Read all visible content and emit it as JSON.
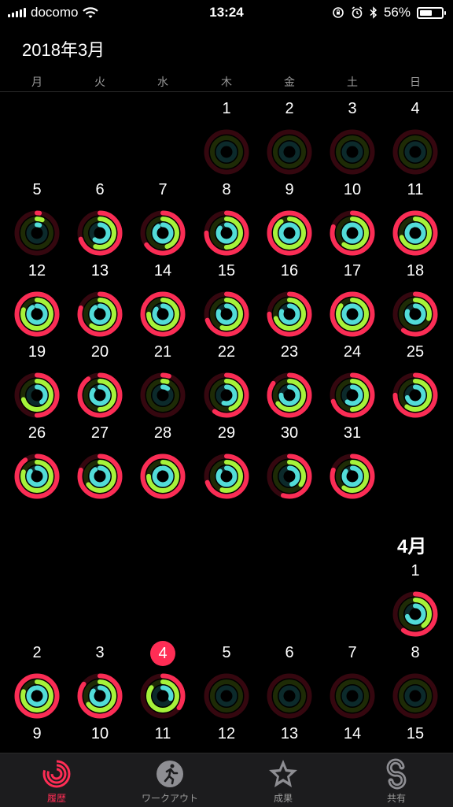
{
  "status": {
    "carrier": "docomo",
    "time": "13:24",
    "battery": "56%",
    "battery_level": 56
  },
  "calendar": {
    "title": "2018年3月",
    "weekdays": [
      "月",
      "火",
      "水",
      "木",
      "金",
      "土",
      "日"
    ],
    "april_label": "4月",
    "march_days": [
      {
        "day": "1",
        "move": 0.0,
        "exercise": 0.0,
        "stand": 0.0
      },
      {
        "day": "2",
        "move": 0.0,
        "exercise": 0.0,
        "stand": 0.0
      },
      {
        "day": "3",
        "move": 0.0,
        "exercise": 0.0,
        "stand": 0.0
      },
      {
        "day": "4",
        "move": 0.0,
        "exercise": 0.0,
        "stand": 0.0
      },
      {
        "day": "5",
        "move": 0.02,
        "exercise": 0.06,
        "stand": 0.05
      },
      {
        "day": "6",
        "move": 0.7,
        "exercise": 0.55,
        "stand": 0.6
      },
      {
        "day": "7",
        "move": 0.65,
        "exercise": 0.45,
        "stand": 0.9
      },
      {
        "day": "8",
        "move": 0.75,
        "exercise": 0.5,
        "stand": 0.85
      },
      {
        "day": "9",
        "move": 1.0,
        "exercise": 0.9,
        "stand": 1.0
      },
      {
        "day": "10",
        "move": 0.8,
        "exercise": 0.6,
        "stand": 1.0
      },
      {
        "day": "11",
        "move": 1.0,
        "exercise": 0.7,
        "stand": 0.95
      },
      {
        "day": "12",
        "move": 1.0,
        "exercise": 0.8,
        "stand": 0.9
      },
      {
        "day": "13",
        "move": 0.8,
        "exercise": 0.6,
        "stand": 0.9
      },
      {
        "day": "14",
        "move": 1.0,
        "exercise": 0.75,
        "stand": 0.85
      },
      {
        "day": "15",
        "move": 0.7,
        "exercise": 0.55,
        "stand": 0.8
      },
      {
        "day": "16",
        "move": 0.75,
        "exercise": 0.7,
        "stand": 0.8
      },
      {
        "day": "17",
        "move": 1.0,
        "exercise": 0.85,
        "stand": 1.0
      },
      {
        "day": "18",
        "move": 0.6,
        "exercise": 0.3,
        "stand": 0.8
      },
      {
        "day": "19",
        "move": 0.5,
        "exercise": 0.7,
        "stand": 0.4
      },
      {
        "day": "20",
        "move": 0.9,
        "exercise": 0.5,
        "stand": 0.85
      },
      {
        "day": "21",
        "move": 0.05,
        "exercise": 0.05,
        "stand": 0.1
      },
      {
        "day": "22",
        "move": 0.6,
        "exercise": 0.45,
        "stand": 0.55
      },
      {
        "day": "23",
        "move": 0.85,
        "exercise": 0.65,
        "stand": 0.75
      },
      {
        "day": "24",
        "move": 0.7,
        "exercise": 0.5,
        "stand": 0.6
      },
      {
        "day": "25",
        "move": 0.75,
        "exercise": 0.6,
        "stand": 0.7
      },
      {
        "day": "26",
        "move": 0.9,
        "exercise": 0.8,
        "stand": 0.85
      },
      {
        "day": "27",
        "move": 0.8,
        "exercise": 0.65,
        "stand": 0.9
      },
      {
        "day": "28",
        "move": 1.0,
        "exercise": 0.75,
        "stand": 0.95
      },
      {
        "day": "29",
        "move": 0.7,
        "exercise": 0.55,
        "stand": 0.85
      },
      {
        "day": "30",
        "move": 0.55,
        "exercise": 0.35,
        "stand": 0.45
      },
      {
        "day": "31",
        "move": 0.8,
        "exercise": 0.6,
        "stand": 0.85
      }
    ],
    "april_days": [
      {
        "day": "1",
        "move": 0.6,
        "exercise": 0.4,
        "stand": 0.7,
        "today": false
      },
      {
        "day": "2",
        "move": 1.0,
        "exercise": 0.8,
        "stand": 0.95,
        "today": false
      },
      {
        "day": "3",
        "move": 0.85,
        "exercise": 0.65,
        "stand": 0.85,
        "today": false
      },
      {
        "day": "4",
        "move": 0.35,
        "exercise": 0.85,
        "stand": 0.3,
        "today": true
      },
      {
        "day": "5",
        "move": 0.0,
        "exercise": 0.0,
        "stand": 0.0,
        "today": false
      },
      {
        "day": "6",
        "move": 0.0,
        "exercise": 0.0,
        "stand": 0.0,
        "today": false
      },
      {
        "day": "7",
        "move": 0.0,
        "exercise": 0.0,
        "stand": 0.0,
        "today": false
      },
      {
        "day": "8",
        "move": 0.0,
        "exercise": 0.0,
        "stand": 0.0,
        "today": false
      },
      {
        "day": "9",
        "today": false
      },
      {
        "day": "10",
        "today": false
      },
      {
        "day": "11",
        "today": false
      },
      {
        "day": "12",
        "today": false
      },
      {
        "day": "13",
        "today": false
      },
      {
        "day": "14",
        "today": false
      },
      {
        "day": "15",
        "today": false
      }
    ]
  },
  "tabs": [
    {
      "label": "履歴",
      "icon": "activity-rings-icon",
      "active": true
    },
    {
      "label": "ワークアウト",
      "icon": "workout-runner-icon",
      "active": false
    },
    {
      "label": "成果",
      "icon": "awards-star-icon",
      "active": false
    },
    {
      "label": "共有",
      "icon": "sharing-icon",
      "active": false
    }
  ],
  "colors": {
    "move": "#fa2d55",
    "exercise": "#a6f23a",
    "stand": "#52dcd8",
    "today": "#ff2d55",
    "background": "#000000",
    "tabbar": "#1c1c1e"
  }
}
